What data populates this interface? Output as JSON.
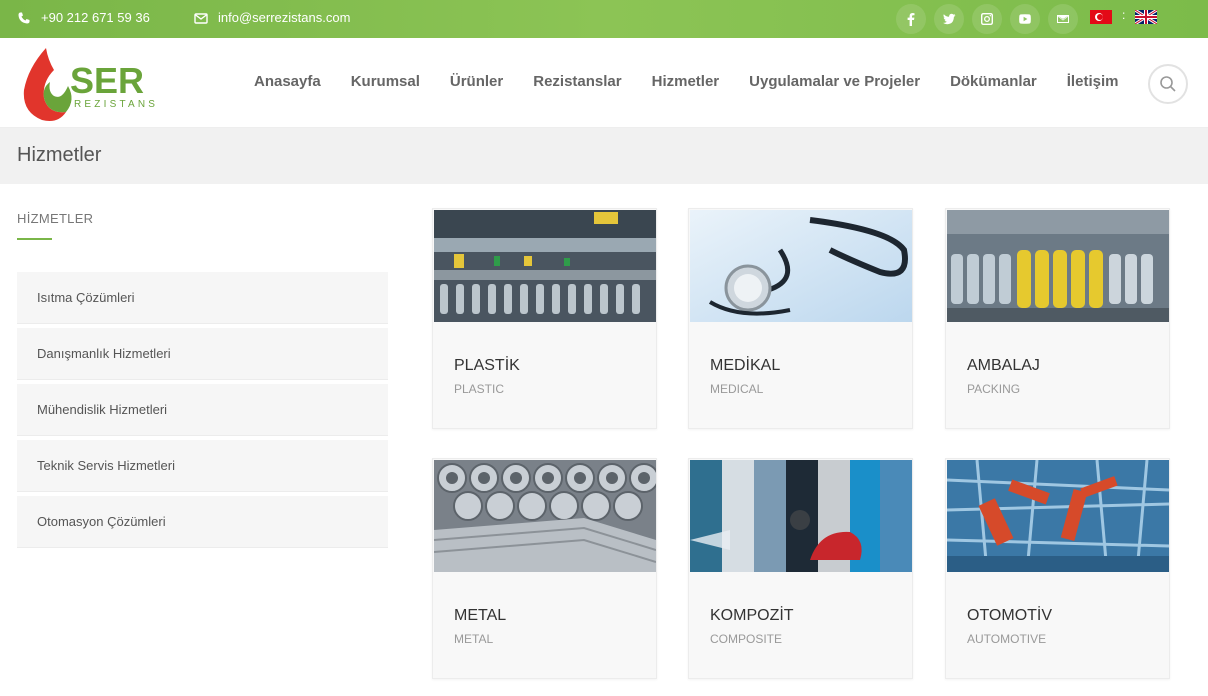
{
  "topbar": {
    "phone": "+90 212 671 59 36",
    "email": "info@serrezistans.com",
    "social_icons": [
      "facebook-icon",
      "twitter-icon",
      "instagram-icon",
      "youtube-icon",
      "mail-icon"
    ],
    "languages": [
      "tr",
      "en"
    ],
    "lang_separator": ":",
    "accent_color": "#7ab648"
  },
  "header": {
    "logo_text": "SER",
    "logo_subtext": "REZISTANS",
    "nav": [
      "Anasayfa",
      "Kurumsal",
      "Ürünler",
      "Rezistanslar",
      "Hizmetler",
      "Uygulamalar ve Projeler",
      "Dökümanlar",
      "İletişim"
    ]
  },
  "page": {
    "title": "Hizmetler"
  },
  "sidebar": {
    "title": "HİZMETLER",
    "items": [
      {
        "label": "Isıtma Çözümleri"
      },
      {
        "label": "Danışmanlık Hizmetleri"
      },
      {
        "label": "Mühendislik Hizmetleri"
      },
      {
        "label": "Teknik Servis Hizmetleri"
      },
      {
        "label": "Otomasyon Çözümleri"
      }
    ]
  },
  "cards": [
    {
      "title": "PLASTİK",
      "subtitle": "PLASTIC"
    },
    {
      "title": "MEDİKAL",
      "subtitle": "MEDICAL"
    },
    {
      "title": "AMBALAJ",
      "subtitle": "PACKING"
    },
    {
      "title": "METAL",
      "subtitle": "METAL"
    },
    {
      "title": "KOMPOZİT",
      "subtitle": "COMPOSITE"
    },
    {
      "title": "OTOMOTİV",
      "subtitle": "AUTOMOTIVE"
    }
  ]
}
